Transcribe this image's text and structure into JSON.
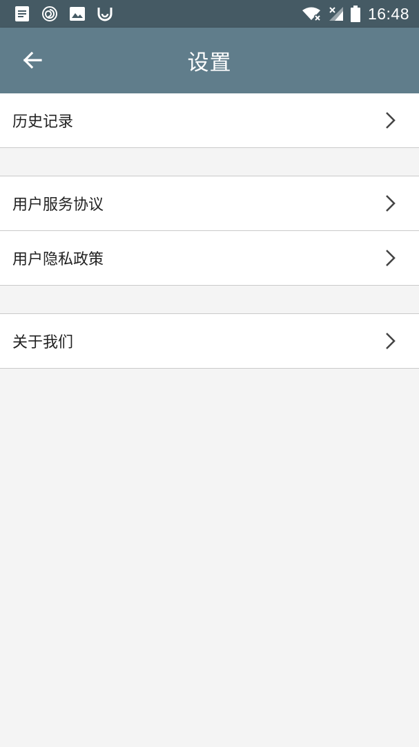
{
  "status_bar": {
    "time": "16:48",
    "icons_left": [
      "notes-icon",
      "swirl-icon",
      "image-icon",
      "smiley-icon"
    ],
    "icons_right": [
      "wifi-off-icon",
      "signal-off-icon",
      "battery-icon"
    ]
  },
  "app_bar": {
    "title": "设置",
    "back_icon": "arrow-left-icon",
    "background": "#607d8b"
  },
  "settings": {
    "group1": [
      {
        "label": "历史记录"
      }
    ],
    "group2": [
      {
        "label": "用户服务协议"
      },
      {
        "label": "用户隐私政策"
      }
    ],
    "group3": [
      {
        "label": "关于我们"
      }
    ]
  },
  "colors": {
    "status_bar": "#455a64",
    "app_bar": "#607d8b",
    "background": "#f4f4f4",
    "divider": "#c9c9c9"
  }
}
